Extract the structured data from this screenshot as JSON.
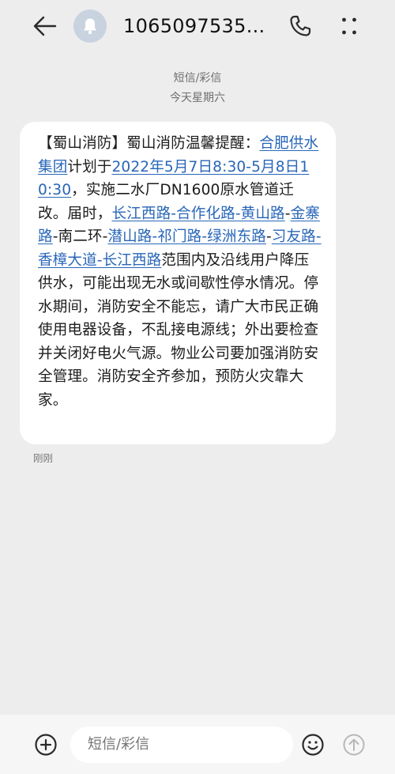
{
  "header": {
    "contact": "1065097535...",
    "back_icon": "arrow-left-icon",
    "avatar_icon": "bell-icon",
    "call_icon": "phone-icon",
    "more_icon": "more-dots-icon"
  },
  "conversation": {
    "message_type": "短信/彩信",
    "date_label": "今天星期六",
    "message": {
      "segments": [
        {
          "text": "【蜀山消防】蜀山消防温馨提醒：",
          "link": false
        },
        {
          "text": "合肥供水集团",
          "link": true
        },
        {
          "text": "计划于",
          "link": false
        },
        {
          "text": "2022年5月7日8:30-5月8日10:30",
          "link": true
        },
        {
          "text": "，实施二水厂DN1600原水管道迁改。届时，",
          "link": false
        },
        {
          "text": "长江西路-合作化路-黄山路",
          "link": true
        },
        {
          "text": "-",
          "link": false
        },
        {
          "text": "金寨路",
          "link": true
        },
        {
          "text": "-南二环-",
          "link": false
        },
        {
          "text": "潜山路-祁门路-绿洲东路",
          "link": true
        },
        {
          "text": "-",
          "link": false
        },
        {
          "text": "习友路-香樟大道-长江西路",
          "link": true
        },
        {
          "text": "范围内及沿线用户降压供水，可能出现无水或间歇性停水情况。停水期间，消防安全不能忘，请广大市民正确使用电器设备，不乱接电源线；外出要检查并关闭好电火气源。物业公司要加强消防安全管理。消防安全齐参加，预防火灾靠大家。",
          "link": false
        }
      ],
      "time": "刚刚"
    }
  },
  "composer": {
    "placeholder": "短信/彩信",
    "add_icon": "plus-circle-icon",
    "emoji_icon": "smiley-icon",
    "send_icon": "send-arrow-icon"
  },
  "colors": {
    "background": "#ededed",
    "bubble": "#ffffff",
    "link": "#2866b8",
    "meta_text": "#6e6e6e"
  }
}
